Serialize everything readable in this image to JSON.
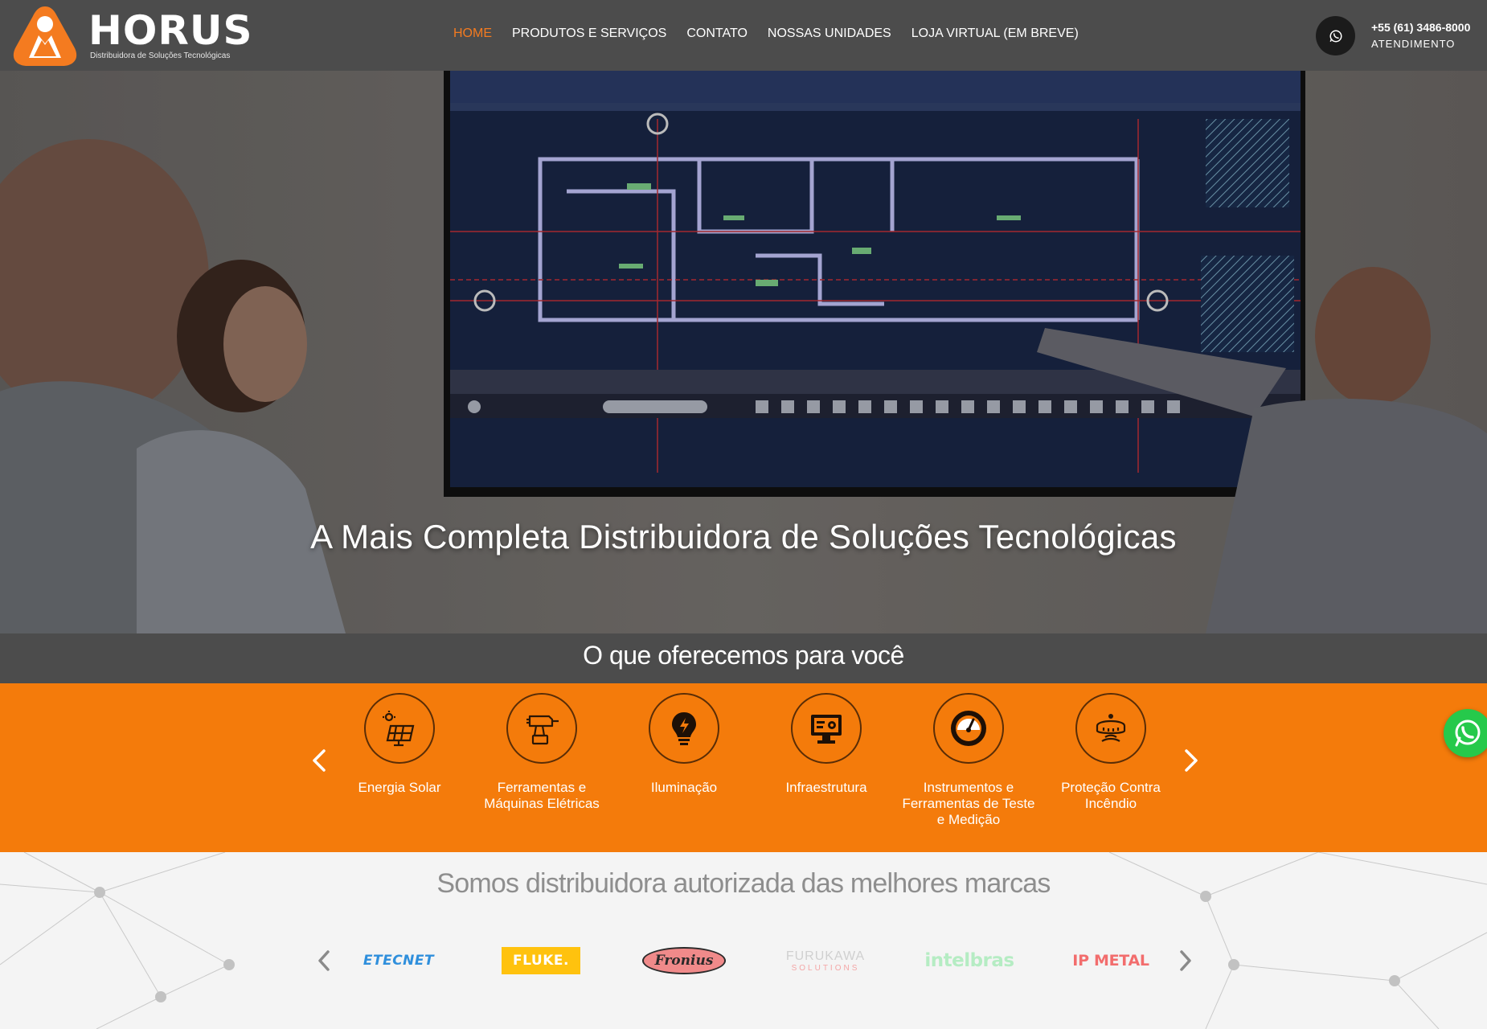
{
  "header": {
    "logo_word": "HORUS",
    "logo_sub": "Distribuidora de Soluções Tecnológicas",
    "nav": [
      {
        "label": "HOME"
      },
      {
        "label": "PRODUTOS E SERVIÇOS"
      },
      {
        "label": "CONTATO"
      },
      {
        "label": "NOSSAS UNIDADES"
      },
      {
        "label": "LOJA VIRTUAL (EM BREVE)"
      }
    ],
    "phone": "+55 (61) 3486-8000",
    "phone_label": "ATENDIMENTO"
  },
  "hero": {
    "title": "A Mais Completa Distribuidora de Soluções Tecnológicas"
  },
  "offer": {
    "title": "O que oferecemos para você",
    "categories": [
      {
        "label": "Energia Solar",
        "icon": "solar-panel-icon"
      },
      {
        "label": "Ferramentas e Máquinas Elétricas",
        "icon": "drill-icon"
      },
      {
        "label": "Iluminação",
        "icon": "lightbulb-icon"
      },
      {
        "label": "Infraestrutura",
        "icon": "infrastructure-icon"
      },
      {
        "label": "Instrumentos e Ferramentas de Teste e Medição",
        "icon": "gauge-icon"
      },
      {
        "label": "Proteção Contra Incêndio",
        "icon": "smoke-detector-icon"
      }
    ]
  },
  "brands": {
    "title": "Somos distribuidora autorizada das melhores marcas",
    "items": [
      {
        "name": "ETECNET"
      },
      {
        "name": "FLUKE."
      },
      {
        "name": "Fronius"
      },
      {
        "name": "FURUKAWA",
        "sub": "SOLUTIONS"
      },
      {
        "name": "intelbras"
      },
      {
        "name": "IP METAL"
      }
    ]
  },
  "colors": {
    "accent": "#f47b0b",
    "header_bg": "#4c4c4c",
    "whatsapp": "#26c94b"
  }
}
